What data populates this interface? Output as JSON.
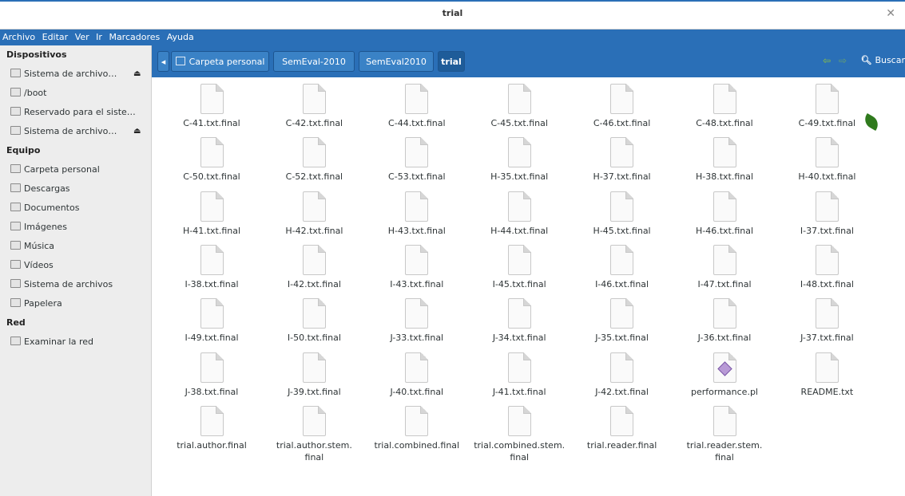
{
  "window": {
    "title": "trial"
  },
  "menu": [
    "Archivo",
    "Editar",
    "Ver",
    "Ir",
    "Marcadores",
    "Ayuda"
  ],
  "sidebar": {
    "sections": [
      {
        "title": "Dispositivos",
        "items": [
          {
            "label": "Sistema de archivo…",
            "icon": "drive-icon",
            "eject": "⏏"
          },
          {
            "label": "/boot",
            "icon": "drive-icon"
          },
          {
            "label": "Reservado para el siste…",
            "icon": "drive-icon"
          },
          {
            "label": "Sistema de archivo…",
            "icon": "drive-icon",
            "eject": "⏏"
          }
        ]
      },
      {
        "title": "Equipo",
        "items": [
          {
            "label": "Carpeta personal",
            "icon": "home-folder-icon"
          },
          {
            "label": "Descargas",
            "icon": "downloads-folder-icon"
          },
          {
            "label": "Documentos",
            "icon": "documents-folder-icon"
          },
          {
            "label": "Imágenes",
            "icon": "pictures-folder-icon"
          },
          {
            "label": "Música",
            "icon": "music-folder-icon"
          },
          {
            "label": "Vídeos",
            "icon": "videos-folder-icon"
          },
          {
            "label": "Sistema de archivos",
            "icon": "filesystem-icon"
          },
          {
            "label": "Papelera",
            "icon": "trash-icon"
          }
        ]
      },
      {
        "title": "Red",
        "items": [
          {
            "label": "Examinar la red",
            "icon": "network-icon"
          }
        ]
      }
    ]
  },
  "pathbar": {
    "back_glyph": "◂",
    "crumbs": [
      "Carpeta personal",
      "SemEval-2010",
      "SemEval2010",
      "trial"
    ],
    "search_label": "Buscar"
  },
  "files": [
    "C-41.txt.final",
    "C-42.txt.final",
    "C-44.txt.final",
    "C-45.txt.final",
    "C-46.txt.final",
    "C-48.txt.final",
    "C-49.txt.final",
    "C-50.txt.final",
    "C-52.txt.final",
    "C-53.txt.final",
    "H-35.txt.final",
    "H-37.txt.final",
    "H-38.txt.final",
    "H-40.txt.final",
    "H-41.txt.final",
    "H-42.txt.final",
    "H-43.txt.final",
    "H-44.txt.final",
    "H-45.txt.final",
    "H-46.txt.final",
    "I-37.txt.final",
    "I-38.txt.final",
    "I-42.txt.final",
    "I-43.txt.final",
    "I-45.txt.final",
    "I-46.txt.final",
    "I-47.txt.final",
    "I-48.txt.final",
    "I-49.txt.final",
    "I-50.txt.final",
    "J-33.txt.final",
    "J-34.txt.final",
    "J-35.txt.final",
    "J-36.txt.final",
    "J-37.txt.final",
    "J-38.txt.final",
    "J-39.txt.final",
    "J-40.txt.final",
    "J-41.txt.final",
    "J-42.txt.final",
    "performance.pl",
    "README.txt",
    "trial.author.final",
    "trial.author.stem.\nfinal",
    "trial.combined.final",
    "trial.combined.stem.\nfinal",
    "trial.reader.final",
    "trial.reader.stem.\nfinal"
  ],
  "colors": {
    "accent": "#2a6fb7",
    "sidebar_bg": "#ededed"
  }
}
